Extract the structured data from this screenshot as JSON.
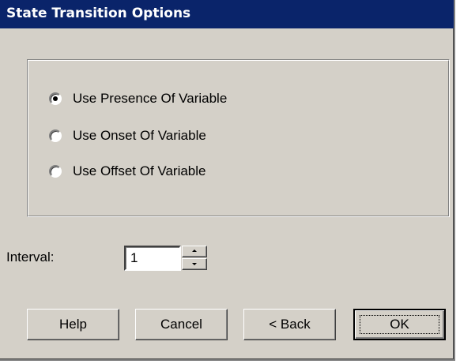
{
  "window": {
    "title": "State Transition Options"
  },
  "transition_options": {
    "selected_index": 0,
    "options": [
      {
        "label": "Use Presence Of Variable",
        "selected": true
      },
      {
        "label": "Use Onset Of Variable",
        "selected": false
      },
      {
        "label": "Use Offset Of Variable",
        "selected": false
      }
    ]
  },
  "interval": {
    "label": "Interval:",
    "value": "1"
  },
  "buttons": {
    "help": "Help",
    "cancel": "Cancel",
    "back": "< Back",
    "ok": "OK"
  },
  "colors": {
    "title_bar": "#0a246a",
    "dialog_face": "#d4d0c8"
  }
}
